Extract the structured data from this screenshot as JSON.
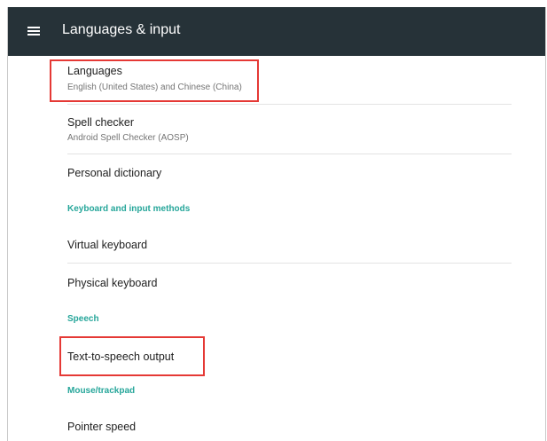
{
  "appbar": {
    "title": "Languages & input",
    "menu_icon": "hamburger-menu-icon",
    "background": "#263238"
  },
  "items": {
    "languages": {
      "title": "Languages",
      "subtitle": "English (United States) and Chinese (China)"
    },
    "spell_checker": {
      "title": "Spell checker",
      "subtitle": "Android Spell Checker (AOSP)"
    },
    "personal_dictionary": {
      "title": "Personal dictionary"
    },
    "virtual_keyboard": {
      "title": "Virtual keyboard"
    },
    "physical_keyboard": {
      "title": "Physical keyboard"
    },
    "tts_output": {
      "title": "Text-to-speech output"
    },
    "pointer_speed": {
      "title": "Pointer speed"
    }
  },
  "categories": {
    "keyboard": "Keyboard and input methods",
    "speech": "Speech",
    "mouse": "Mouse/trackpad"
  },
  "colors": {
    "category_accent": "#26a69a",
    "highlight_box": "#e53935"
  }
}
